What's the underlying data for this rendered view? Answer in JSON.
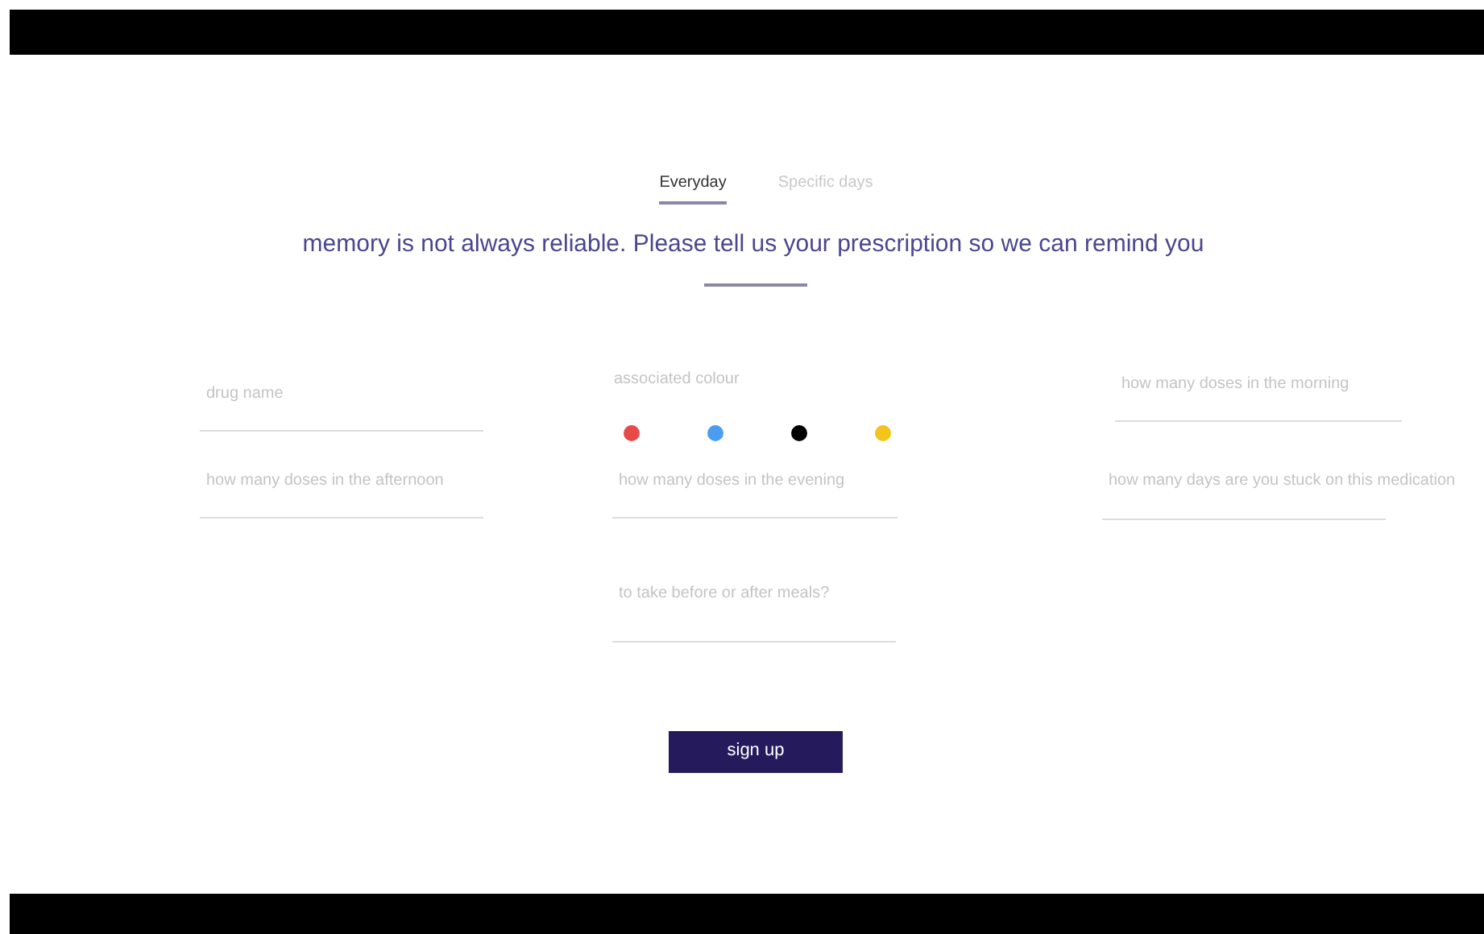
{
  "tabs": [
    {
      "label": "Everyday",
      "selected": true
    },
    {
      "label": "Specific days",
      "selected": false
    }
  ],
  "heading": "memory is not always reliable. Please tell us your prescription so we can remind you",
  "fields": [
    {
      "placeholder": "drug name"
    },
    {
      "placeholder": "how many doses in the morning"
    },
    {
      "placeholder": "how many doses in the afternoon"
    },
    {
      "placeholder": "how many doses in the evening"
    },
    {
      "placeholder": "how many days are you stuck on this medication"
    },
    {
      "placeholder": "to take before or after meals?"
    }
  ],
  "colour_picker": {
    "label": "associated colour",
    "swatches": [
      {
        "color": "#e84a4a"
      },
      {
        "color": "#4a9df0"
      },
      {
        "color": "#000000"
      },
      {
        "color": "#f2c41c"
      }
    ]
  },
  "submit_button": "sign up"
}
